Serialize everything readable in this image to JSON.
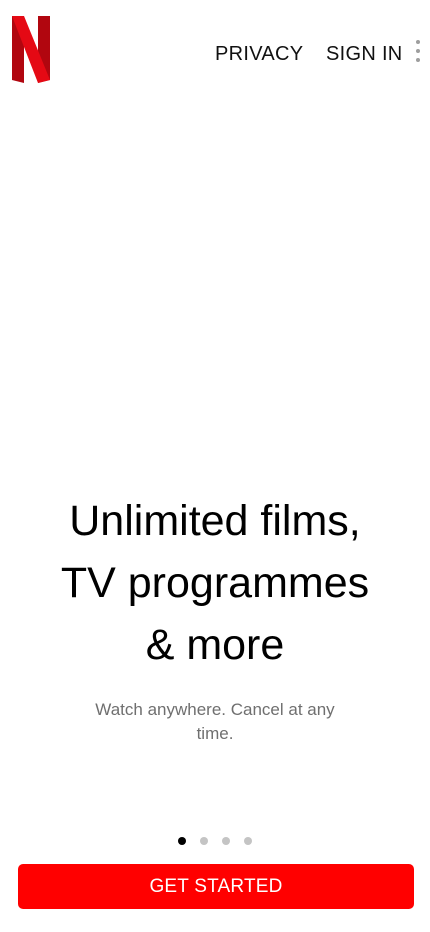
{
  "header": {
    "logo_icon": "netflix-n-logo",
    "brand_colors": [
      "#b1060f",
      "#e50914"
    ],
    "privacy_label": "PRIVACY",
    "signin_label": "SIGN IN",
    "more_icon": "vertical-ellipsis-icon"
  },
  "hero": {
    "headline_line1": "Unlimited films,",
    "headline_line2": "TV programmes",
    "headline_line3": "& more",
    "subtext": "Watch anywhere. Cancel at any time."
  },
  "pager": {
    "total_pages": 4,
    "active_page": 1
  },
  "cta": {
    "label": "GET STARTED",
    "color": "#ff0000"
  }
}
